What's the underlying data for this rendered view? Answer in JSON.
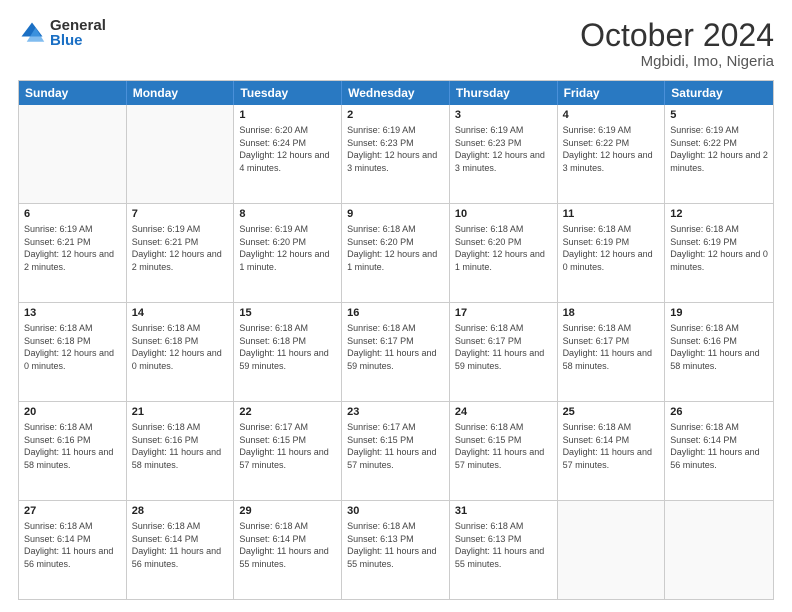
{
  "logo": {
    "general": "General",
    "blue": "Blue"
  },
  "title": {
    "month": "October 2024",
    "location": "Mgbidi, Imo, Nigeria"
  },
  "header_days": [
    "Sunday",
    "Monday",
    "Tuesday",
    "Wednesday",
    "Thursday",
    "Friday",
    "Saturday"
  ],
  "weeks": [
    [
      {
        "day": "",
        "info": ""
      },
      {
        "day": "",
        "info": ""
      },
      {
        "day": "1",
        "info": "Sunrise: 6:20 AM\nSunset: 6:24 PM\nDaylight: 12 hours and 4 minutes."
      },
      {
        "day": "2",
        "info": "Sunrise: 6:19 AM\nSunset: 6:23 PM\nDaylight: 12 hours and 3 minutes."
      },
      {
        "day": "3",
        "info": "Sunrise: 6:19 AM\nSunset: 6:23 PM\nDaylight: 12 hours and 3 minutes."
      },
      {
        "day": "4",
        "info": "Sunrise: 6:19 AM\nSunset: 6:22 PM\nDaylight: 12 hours and 3 minutes."
      },
      {
        "day": "5",
        "info": "Sunrise: 6:19 AM\nSunset: 6:22 PM\nDaylight: 12 hours and 2 minutes."
      }
    ],
    [
      {
        "day": "6",
        "info": "Sunrise: 6:19 AM\nSunset: 6:21 PM\nDaylight: 12 hours and 2 minutes."
      },
      {
        "day": "7",
        "info": "Sunrise: 6:19 AM\nSunset: 6:21 PM\nDaylight: 12 hours and 2 minutes."
      },
      {
        "day": "8",
        "info": "Sunrise: 6:19 AM\nSunset: 6:20 PM\nDaylight: 12 hours and 1 minute."
      },
      {
        "day": "9",
        "info": "Sunrise: 6:18 AM\nSunset: 6:20 PM\nDaylight: 12 hours and 1 minute."
      },
      {
        "day": "10",
        "info": "Sunrise: 6:18 AM\nSunset: 6:20 PM\nDaylight: 12 hours and 1 minute."
      },
      {
        "day": "11",
        "info": "Sunrise: 6:18 AM\nSunset: 6:19 PM\nDaylight: 12 hours and 0 minutes."
      },
      {
        "day": "12",
        "info": "Sunrise: 6:18 AM\nSunset: 6:19 PM\nDaylight: 12 hours and 0 minutes."
      }
    ],
    [
      {
        "day": "13",
        "info": "Sunrise: 6:18 AM\nSunset: 6:18 PM\nDaylight: 12 hours and 0 minutes."
      },
      {
        "day": "14",
        "info": "Sunrise: 6:18 AM\nSunset: 6:18 PM\nDaylight: 12 hours and 0 minutes."
      },
      {
        "day": "15",
        "info": "Sunrise: 6:18 AM\nSunset: 6:18 PM\nDaylight: 11 hours and 59 minutes."
      },
      {
        "day": "16",
        "info": "Sunrise: 6:18 AM\nSunset: 6:17 PM\nDaylight: 11 hours and 59 minutes."
      },
      {
        "day": "17",
        "info": "Sunrise: 6:18 AM\nSunset: 6:17 PM\nDaylight: 11 hours and 59 minutes."
      },
      {
        "day": "18",
        "info": "Sunrise: 6:18 AM\nSunset: 6:17 PM\nDaylight: 11 hours and 58 minutes."
      },
      {
        "day": "19",
        "info": "Sunrise: 6:18 AM\nSunset: 6:16 PM\nDaylight: 11 hours and 58 minutes."
      }
    ],
    [
      {
        "day": "20",
        "info": "Sunrise: 6:18 AM\nSunset: 6:16 PM\nDaylight: 11 hours and 58 minutes."
      },
      {
        "day": "21",
        "info": "Sunrise: 6:18 AM\nSunset: 6:16 PM\nDaylight: 11 hours and 58 minutes."
      },
      {
        "day": "22",
        "info": "Sunrise: 6:17 AM\nSunset: 6:15 PM\nDaylight: 11 hours and 57 minutes."
      },
      {
        "day": "23",
        "info": "Sunrise: 6:17 AM\nSunset: 6:15 PM\nDaylight: 11 hours and 57 minutes."
      },
      {
        "day": "24",
        "info": "Sunrise: 6:18 AM\nSunset: 6:15 PM\nDaylight: 11 hours and 57 minutes."
      },
      {
        "day": "25",
        "info": "Sunrise: 6:18 AM\nSunset: 6:14 PM\nDaylight: 11 hours and 57 minutes."
      },
      {
        "day": "26",
        "info": "Sunrise: 6:18 AM\nSunset: 6:14 PM\nDaylight: 11 hours and 56 minutes."
      }
    ],
    [
      {
        "day": "27",
        "info": "Sunrise: 6:18 AM\nSunset: 6:14 PM\nDaylight: 11 hours and 56 minutes."
      },
      {
        "day": "28",
        "info": "Sunrise: 6:18 AM\nSunset: 6:14 PM\nDaylight: 11 hours and 56 minutes."
      },
      {
        "day": "29",
        "info": "Sunrise: 6:18 AM\nSunset: 6:14 PM\nDaylight: 11 hours and 55 minutes."
      },
      {
        "day": "30",
        "info": "Sunrise: 6:18 AM\nSunset: 6:13 PM\nDaylight: 11 hours and 55 minutes."
      },
      {
        "day": "31",
        "info": "Sunrise: 6:18 AM\nSunset: 6:13 PM\nDaylight: 11 hours and 55 minutes."
      },
      {
        "day": "",
        "info": ""
      },
      {
        "day": "",
        "info": ""
      }
    ]
  ]
}
